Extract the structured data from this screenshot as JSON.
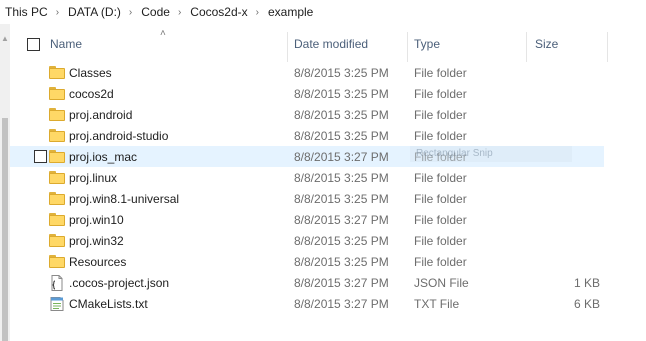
{
  "breadcrumb": [
    "This PC",
    "DATA (D:)",
    "Code",
    "Cocos2d-x",
    "example"
  ],
  "columns": {
    "name": "Name",
    "date": "Date modified",
    "type": "Type",
    "size": "Size"
  },
  "rows": [
    {
      "name": "Classes",
      "date": "8/8/2015 3:25 PM",
      "type": "File folder",
      "size": "",
      "icon": "folder-icon"
    },
    {
      "name": "cocos2d",
      "date": "8/8/2015 3:25 PM",
      "type": "File folder",
      "size": "",
      "icon": "folder-icon"
    },
    {
      "name": "proj.android",
      "date": "8/8/2015 3:25 PM",
      "type": "File folder",
      "size": "",
      "icon": "folder-icon"
    },
    {
      "name": "proj.android-studio",
      "date": "8/8/2015 3:25 PM",
      "type": "File folder",
      "size": "",
      "icon": "folder-icon"
    },
    {
      "name": "proj.ios_mac",
      "date": "8/8/2015 3:27 PM",
      "type": "File folder",
      "size": "",
      "icon": "folder-icon",
      "hover": true
    },
    {
      "name": "proj.linux",
      "date": "8/8/2015 3:25 PM",
      "type": "File folder",
      "size": "",
      "icon": "folder-icon"
    },
    {
      "name": "proj.win8.1-universal",
      "date": "8/8/2015 3:25 PM",
      "type": "File folder",
      "size": "",
      "icon": "folder-icon"
    },
    {
      "name": "proj.win10",
      "date": "8/8/2015 3:27 PM",
      "type": "File folder",
      "size": "",
      "icon": "folder-icon"
    },
    {
      "name": "proj.win32",
      "date": "8/8/2015 3:25 PM",
      "type": "File folder",
      "size": "",
      "icon": "folder-icon"
    },
    {
      "name": "Resources",
      "date": "8/8/2015 3:25 PM",
      "type": "File folder",
      "size": "",
      "icon": "folder-icon"
    },
    {
      "name": ".cocos-project.json",
      "date": "8/8/2015 3:27 PM",
      "type": "JSON File",
      "size": "1 KB",
      "icon": "json-file-icon"
    },
    {
      "name": "CMakeLists.txt",
      "date": "8/8/2015 3:27 PM",
      "type": "TXT File",
      "size": "6 KB",
      "icon": "text-file-icon"
    }
  ],
  "overlay": {
    "ghost_text": "Rectangular Snip"
  },
  "colors": {
    "hover": "#e5f3ff",
    "header_text": "#4c607a",
    "folder": "#ffd866"
  }
}
